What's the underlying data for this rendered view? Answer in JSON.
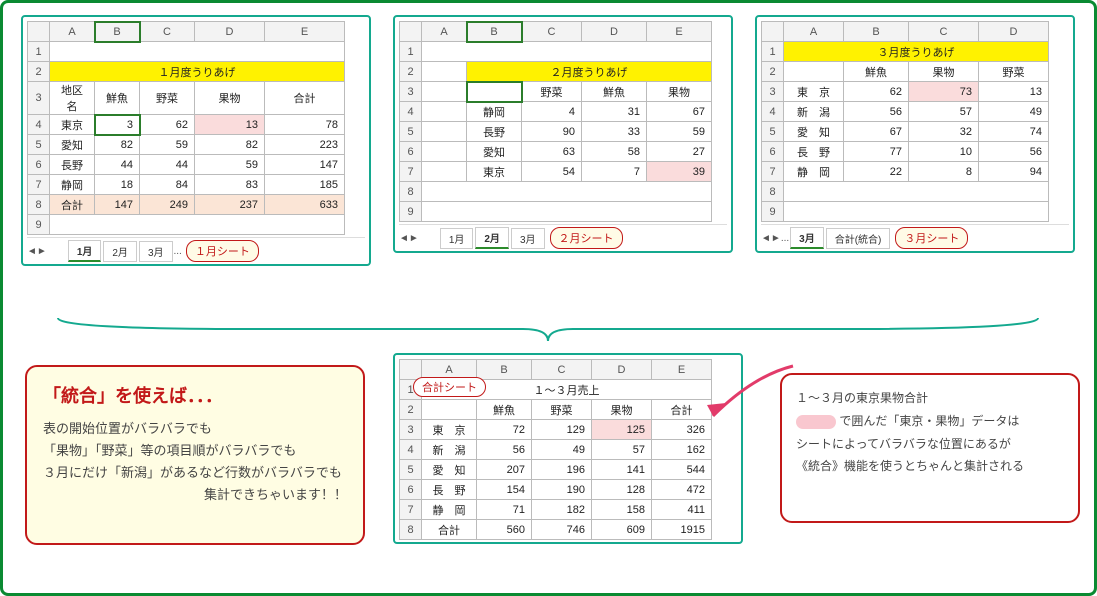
{
  "sheet1": {
    "title": "１月度うりあげ",
    "cols": [
      "A",
      "B",
      "C",
      "D",
      "E"
    ],
    "headers": [
      "地区名",
      "鮮魚",
      "野菜",
      "果物",
      "合計"
    ],
    "rows": [
      {
        "name": "東京",
        "v": [
          3,
          62,
          13,
          78
        ]
      },
      {
        "name": "愛知",
        "v": [
          82,
          59,
          82,
          223
        ]
      },
      {
        "name": "長野",
        "v": [
          44,
          44,
          59,
          147
        ]
      },
      {
        "name": "静岡",
        "v": [
          18,
          84,
          83,
          185
        ]
      },
      {
        "name": "合計",
        "v": [
          147,
          249,
          237,
          633
        ]
      }
    ],
    "tabs": [
      "1月",
      "2月",
      "3月"
    ],
    "active_tab": "1月",
    "callout": "１月シート"
  },
  "sheet2": {
    "title": "２月度うりあげ",
    "cols": [
      "A",
      "B",
      "C",
      "D",
      "E"
    ],
    "headers": [
      "",
      "野菜",
      "鮮魚",
      "果物"
    ],
    "rows": [
      {
        "name": "静岡",
        "v": [
          4,
          31,
          67
        ]
      },
      {
        "name": "長野",
        "v": [
          90,
          33,
          59
        ]
      },
      {
        "name": "愛知",
        "v": [
          63,
          58,
          27
        ]
      },
      {
        "name": "東京",
        "v": [
          54,
          7,
          39
        ]
      }
    ],
    "tabs": [
      "1月",
      "2月",
      "3月"
    ],
    "active_tab": "2月",
    "callout": "２月シート"
  },
  "sheet3": {
    "title": "３月度うりあげ",
    "cols": [
      "A",
      "B",
      "C",
      "D"
    ],
    "headers": [
      "",
      "鮮魚",
      "果物",
      "野菜"
    ],
    "rows": [
      {
        "name": "東　京",
        "v": [
          62,
          73,
          13
        ]
      },
      {
        "name": "新　潟",
        "v": [
          56,
          57,
          49
        ]
      },
      {
        "name": "愛　知",
        "v": [
          67,
          32,
          74
        ]
      },
      {
        "name": "長　野",
        "v": [
          77,
          10,
          56
        ]
      },
      {
        "name": "静　岡",
        "v": [
          22,
          8,
          94
        ]
      }
    ],
    "tabs": [
      "3月",
      "合計(統合)"
    ],
    "active_tab": "3月",
    "callout": "３月シート",
    "ellipsis": "..."
  },
  "sheetTotal": {
    "title": "１～３月売上",
    "cols": [
      "A",
      "B",
      "C",
      "D",
      "E"
    ],
    "headers": [
      "",
      "鮮魚",
      "野菜",
      "果物",
      "合計"
    ],
    "rows": [
      {
        "name": "東　京",
        "v": [
          72,
          129,
          125,
          326
        ]
      },
      {
        "name": "新　潟",
        "v": [
          56,
          49,
          57,
          162
        ]
      },
      {
        "name": "愛　知",
        "v": [
          207,
          196,
          141,
          544
        ]
      },
      {
        "name": "長　野",
        "v": [
          154,
          190,
          128,
          472
        ]
      },
      {
        "name": "静　岡",
        "v": [
          71,
          182,
          158,
          411
        ]
      },
      {
        "name": "合計",
        "v": [
          560,
          746,
          609,
          1915
        ]
      }
    ],
    "callout": "合計シート"
  },
  "noteLeft": {
    "title": "「統合」を使えば．．．",
    "l1": "表の開始位置がバラバラでも",
    "l2": "「果物」「野菜」等の項目順がバラバラでも",
    "l3": "３月にだけ「新潟」があるなど行数がバラバラでも",
    "l4": "集計できちゃいます！！"
  },
  "noteRight": {
    "l1": "１～３月の東京果物合計",
    "l2a": "で囲んだ「東京・果物」データは",
    "l3": "シートによってバラバラな位置にあるが",
    "l4": "《統合》機能を使うとちゃんと集計される"
  },
  "icons": {
    "left": "◄",
    "right": "►",
    "ellipsis": "..."
  }
}
